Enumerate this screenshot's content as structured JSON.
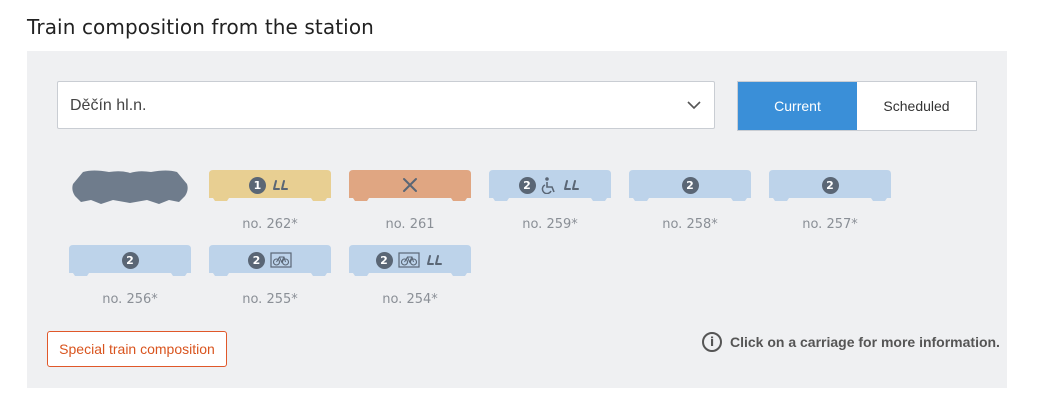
{
  "page": {
    "title": "Train composition from the station"
  },
  "station": {
    "value": "Děčín hl.n."
  },
  "toggle": {
    "current": "Current",
    "scheduled": "Scheduled"
  },
  "colors": {
    "first_class": "#e8cf92",
    "dining": "#e0a682",
    "second_class": "#bdd3ea",
    "locomotive": "#6f7c8c",
    "accent": "#3a8fd8",
    "special": "#e0582a"
  },
  "cars": [
    {
      "type": "locomotive",
      "label": "",
      "class": "",
      "icons": []
    },
    {
      "type": "first_class",
      "label": "no. 262*",
      "class": "1",
      "icons": [
        "seat-icon"
      ]
    },
    {
      "type": "dining",
      "label": "no. 261",
      "class": "",
      "icons": [
        "restaurant-icon"
      ]
    },
    {
      "type": "second_class",
      "label": "no. 259*",
      "class": "2",
      "icons": [
        "wheelchair-icon",
        "seat-icon"
      ]
    },
    {
      "type": "second_class",
      "label": "no. 258*",
      "class": "2",
      "icons": []
    },
    {
      "type": "second_class",
      "label": "no. 257*",
      "class": "2",
      "icons": []
    },
    {
      "type": "second_class",
      "label": "no. 256*",
      "class": "2",
      "icons": []
    },
    {
      "type": "second_class",
      "label": "no. 255*",
      "class": "2",
      "icons": [
        "bicycle-icon"
      ]
    },
    {
      "type": "second_class",
      "label": "no. 254*",
      "class": "2",
      "icons": [
        "bicycle-icon",
        "seat-icon"
      ]
    }
  ],
  "special_button": "Special train composition",
  "info": {
    "text": "Click on a carriage for more information.",
    "icon_glyph": "i"
  }
}
